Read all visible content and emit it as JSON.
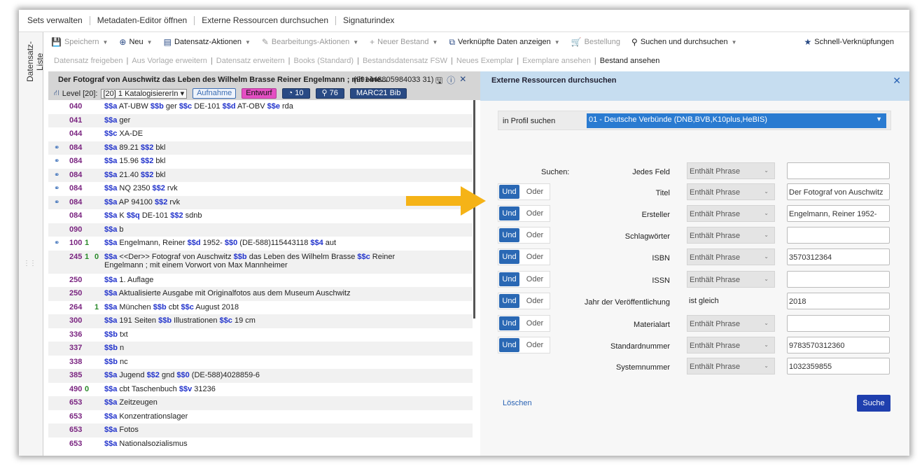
{
  "topnav": [
    "Sets verwalten",
    "Metadaten-Editor öffnen",
    "Externe Ressourcen durchsuchen",
    "Signaturindex"
  ],
  "sidebar": {
    "label": "Datensatz-Liste"
  },
  "toolbar": {
    "save": "Speichern",
    "new": "Neu",
    "record_actions": "Datensatz-Aktionen",
    "edit_actions": "Bearbeitungs-Aktionen",
    "new_holding": "Neuer Bestand",
    "linked_data": "Verknüpfte Daten anzeigen",
    "order": "Bestellung",
    "search": "Suchen und durchsuchen",
    "shortcuts": "Schnell-Verknüpfungen"
  },
  "subbar": [
    "Datensatz freigeben",
    "Aus Vorlage erweitern",
    "Datensatz erweitern",
    "Books (Standard)",
    "Bestandsdatensatz FSW",
    "Neues Exemplar",
    "Exemplare ansehen",
    "Bestand ansehen"
  ],
  "record": {
    "title": "Der Fotograf von Auschwitz das Leben des Wilhelm Brasse Reiner Engelmann ; mit eine...",
    "id": "(991448805984033 31)",
    "level_label": "Level [20]:",
    "level_value": "[20] 1 KatalogisiererIn",
    "badge_aufnahme": "Aufnahme",
    "badge_entwurf": "Entwurf",
    "badge_count1": "10",
    "badge_count2": "76",
    "badge_format": "MARC21 Bib"
  },
  "fields": [
    {
      "tag": "040",
      "i1": "",
      "i2": "",
      "bin": false,
      "parts": [
        [
          "$$a",
          " AT-UBW "
        ],
        [
          "$$b",
          " ger "
        ],
        [
          "$$c",
          " DE-101 "
        ],
        [
          "$$d",
          " AT-OBV "
        ],
        [
          "$$e",
          " rda"
        ]
      ]
    },
    {
      "tag": "041",
      "i1": "",
      "i2": "",
      "bin": false,
      "parts": [
        [
          "$$a",
          " ger"
        ]
      ]
    },
    {
      "tag": "044",
      "i1": "",
      "i2": "",
      "bin": false,
      "parts": [
        [
          "$$c",
          " XA-DE"
        ]
      ]
    },
    {
      "tag": "084",
      "i1": "",
      "i2": "",
      "bin": true,
      "parts": [
        [
          "$$a",
          " 89.21 "
        ],
        [
          "$$2",
          " bkl"
        ]
      ]
    },
    {
      "tag": "084",
      "i1": "",
      "i2": "",
      "bin": true,
      "parts": [
        [
          "$$a",
          " 15.96 "
        ],
        [
          "$$2",
          " bkl"
        ]
      ]
    },
    {
      "tag": "084",
      "i1": "",
      "i2": "",
      "bin": true,
      "parts": [
        [
          "$$a",
          " 21.40 "
        ],
        [
          "$$2",
          " bkl"
        ]
      ]
    },
    {
      "tag": "084",
      "i1": "",
      "i2": "",
      "bin": true,
      "parts": [
        [
          "$$a",
          " NQ 2350 "
        ],
        [
          "$$2",
          " rvk"
        ]
      ]
    },
    {
      "tag": "084",
      "i1": "",
      "i2": "",
      "bin": true,
      "parts": [
        [
          "$$a",
          " AP 94100 "
        ],
        [
          "$$2",
          " rvk"
        ]
      ]
    },
    {
      "tag": "084",
      "i1": "",
      "i2": "",
      "bin": false,
      "parts": [
        [
          "$$a",
          " K "
        ],
        [
          "$$q",
          " DE-101 "
        ],
        [
          "$$2",
          " sdnb"
        ]
      ]
    },
    {
      "tag": "090",
      "i1": "",
      "i2": "",
      "bin": false,
      "parts": [
        [
          "$$a",
          " b"
        ]
      ]
    },
    {
      "tag": "100",
      "i1": "1",
      "i2": "",
      "bin": true,
      "parts": [
        [
          "$$a",
          " Engelmann, Reiner "
        ],
        [
          "$$d",
          " 1952- "
        ],
        [
          "$$0",
          " (DE-588)115443118 "
        ],
        [
          "$$4",
          " aut"
        ]
      ]
    },
    {
      "tag": "245",
      "i1": "1",
      "i2": "0",
      "bin": false,
      "tall": true,
      "parts": [
        [
          "$$a",
          " <<Der>> Fotograf von Auschwitz "
        ],
        [
          "$$b",
          " das Leben des Wilhelm Brasse "
        ],
        [
          "$$c",
          " Reiner Engelmann ; mit einem Vorwort von Max Mannheimer"
        ]
      ]
    },
    {
      "tag": "250",
      "i1": "",
      "i2": "",
      "bin": false,
      "parts": [
        [
          "$$a",
          " 1. Auflage"
        ]
      ]
    },
    {
      "tag": "250",
      "i1": "",
      "i2": "",
      "bin": false,
      "parts": [
        [
          "$$a",
          " Aktualisierte Ausgabe mit Originalfotos aus dem Museum Auschwitz"
        ]
      ]
    },
    {
      "tag": "264",
      "i1": "",
      "i2": "1",
      "bin": false,
      "parts": [
        [
          "$$a",
          " München "
        ],
        [
          "$$b",
          " cbt "
        ],
        [
          "$$c",
          " August 2018"
        ]
      ]
    },
    {
      "tag": "300",
      "i1": "",
      "i2": "",
      "bin": false,
      "parts": [
        [
          "$$a",
          " 191 Seiten "
        ],
        [
          "$$b",
          " Illustrationen "
        ],
        [
          "$$c",
          " 19 cm"
        ]
      ]
    },
    {
      "tag": "336",
      "i1": "",
      "i2": "",
      "bin": false,
      "parts": [
        [
          "$$b",
          " txt"
        ]
      ]
    },
    {
      "tag": "337",
      "i1": "",
      "i2": "",
      "bin": false,
      "parts": [
        [
          "$$b",
          " n"
        ]
      ]
    },
    {
      "tag": "338",
      "i1": "",
      "i2": "",
      "bin": false,
      "parts": [
        [
          "$$b",
          " nc"
        ]
      ]
    },
    {
      "tag": "385",
      "i1": "",
      "i2": "",
      "bin": false,
      "parts": [
        [
          "$$a",
          " Jugend "
        ],
        [
          "$$2",
          " gnd "
        ],
        [
          "$$0",
          " (DE-588)4028859-6"
        ]
      ]
    },
    {
      "tag": "490",
      "i1": "0",
      "i2": "",
      "bin": false,
      "parts": [
        [
          "$$a",
          " cbt Taschenbuch "
        ],
        [
          "$$v",
          " 31236"
        ]
      ]
    },
    {
      "tag": "653",
      "i1": "",
      "i2": "",
      "bin": false,
      "parts": [
        [
          "$$a",
          " Zeitzeugen"
        ]
      ]
    },
    {
      "tag": "653",
      "i1": "",
      "i2": "",
      "bin": false,
      "parts": [
        [
          "$$a",
          " Konzentrationslager"
        ]
      ]
    },
    {
      "tag": "653",
      "i1": "",
      "i2": "",
      "bin": false,
      "parts": [
        [
          "$$a",
          " Fotos"
        ]
      ]
    },
    {
      "tag": "653",
      "i1": "",
      "i2": "",
      "bin": false,
      "parts": [
        [
          "$$a",
          " Nationalsozialismus"
        ]
      ]
    }
  ],
  "external": {
    "title": "Externe Ressourcen durchsuchen",
    "profile_label": "in Profil suchen",
    "profile_value": "01 - Deutsche Verbünde (DNB,BVB,K10plus,HeBIS)",
    "suchen_label": "Suchen:",
    "und": "Und",
    "oder": "Oder",
    "rows": [
      {
        "label": "Jedes Feld",
        "op": "Enthält Phrase",
        "value": "",
        "andor": false
      },
      {
        "label": "Titel",
        "op": "Enthält Phrase",
        "value": "Der Fotograf von Auschwitz",
        "andor": true
      },
      {
        "label": "Ersteller",
        "op": "Enthält Phrase",
        "value": "Engelmann, Reiner 1952-",
        "andor": true
      },
      {
        "label": "Schlagwörter",
        "op": "Enthält Phrase",
        "value": "",
        "andor": true
      },
      {
        "label": "ISBN",
        "op": "Enthält Phrase",
        "value": "3570312364",
        "andor": true
      },
      {
        "label": "ISSN",
        "op": "Enthält Phrase",
        "value": "",
        "andor": true
      },
      {
        "label": "Jahr der Veröffentlichung",
        "op": "ist gleich",
        "value": "2018",
        "andor": true,
        "plain": true
      },
      {
        "label": "Materialart",
        "op": "Enthält Phrase",
        "value": "",
        "andor": true
      },
      {
        "label": "Standardnummer",
        "op": "Enthält Phrase",
        "value": "9783570312360",
        "andor": true
      },
      {
        "label": "Systemnummer",
        "op": "Enthält Phrase",
        "value": "1032359855",
        "andor": false
      }
    ],
    "clear": "Löschen",
    "search": "Suche"
  },
  "colors": {
    "accent": "#2a68b4",
    "arrow": "#f5b317",
    "search_button": "#1f3fae"
  }
}
